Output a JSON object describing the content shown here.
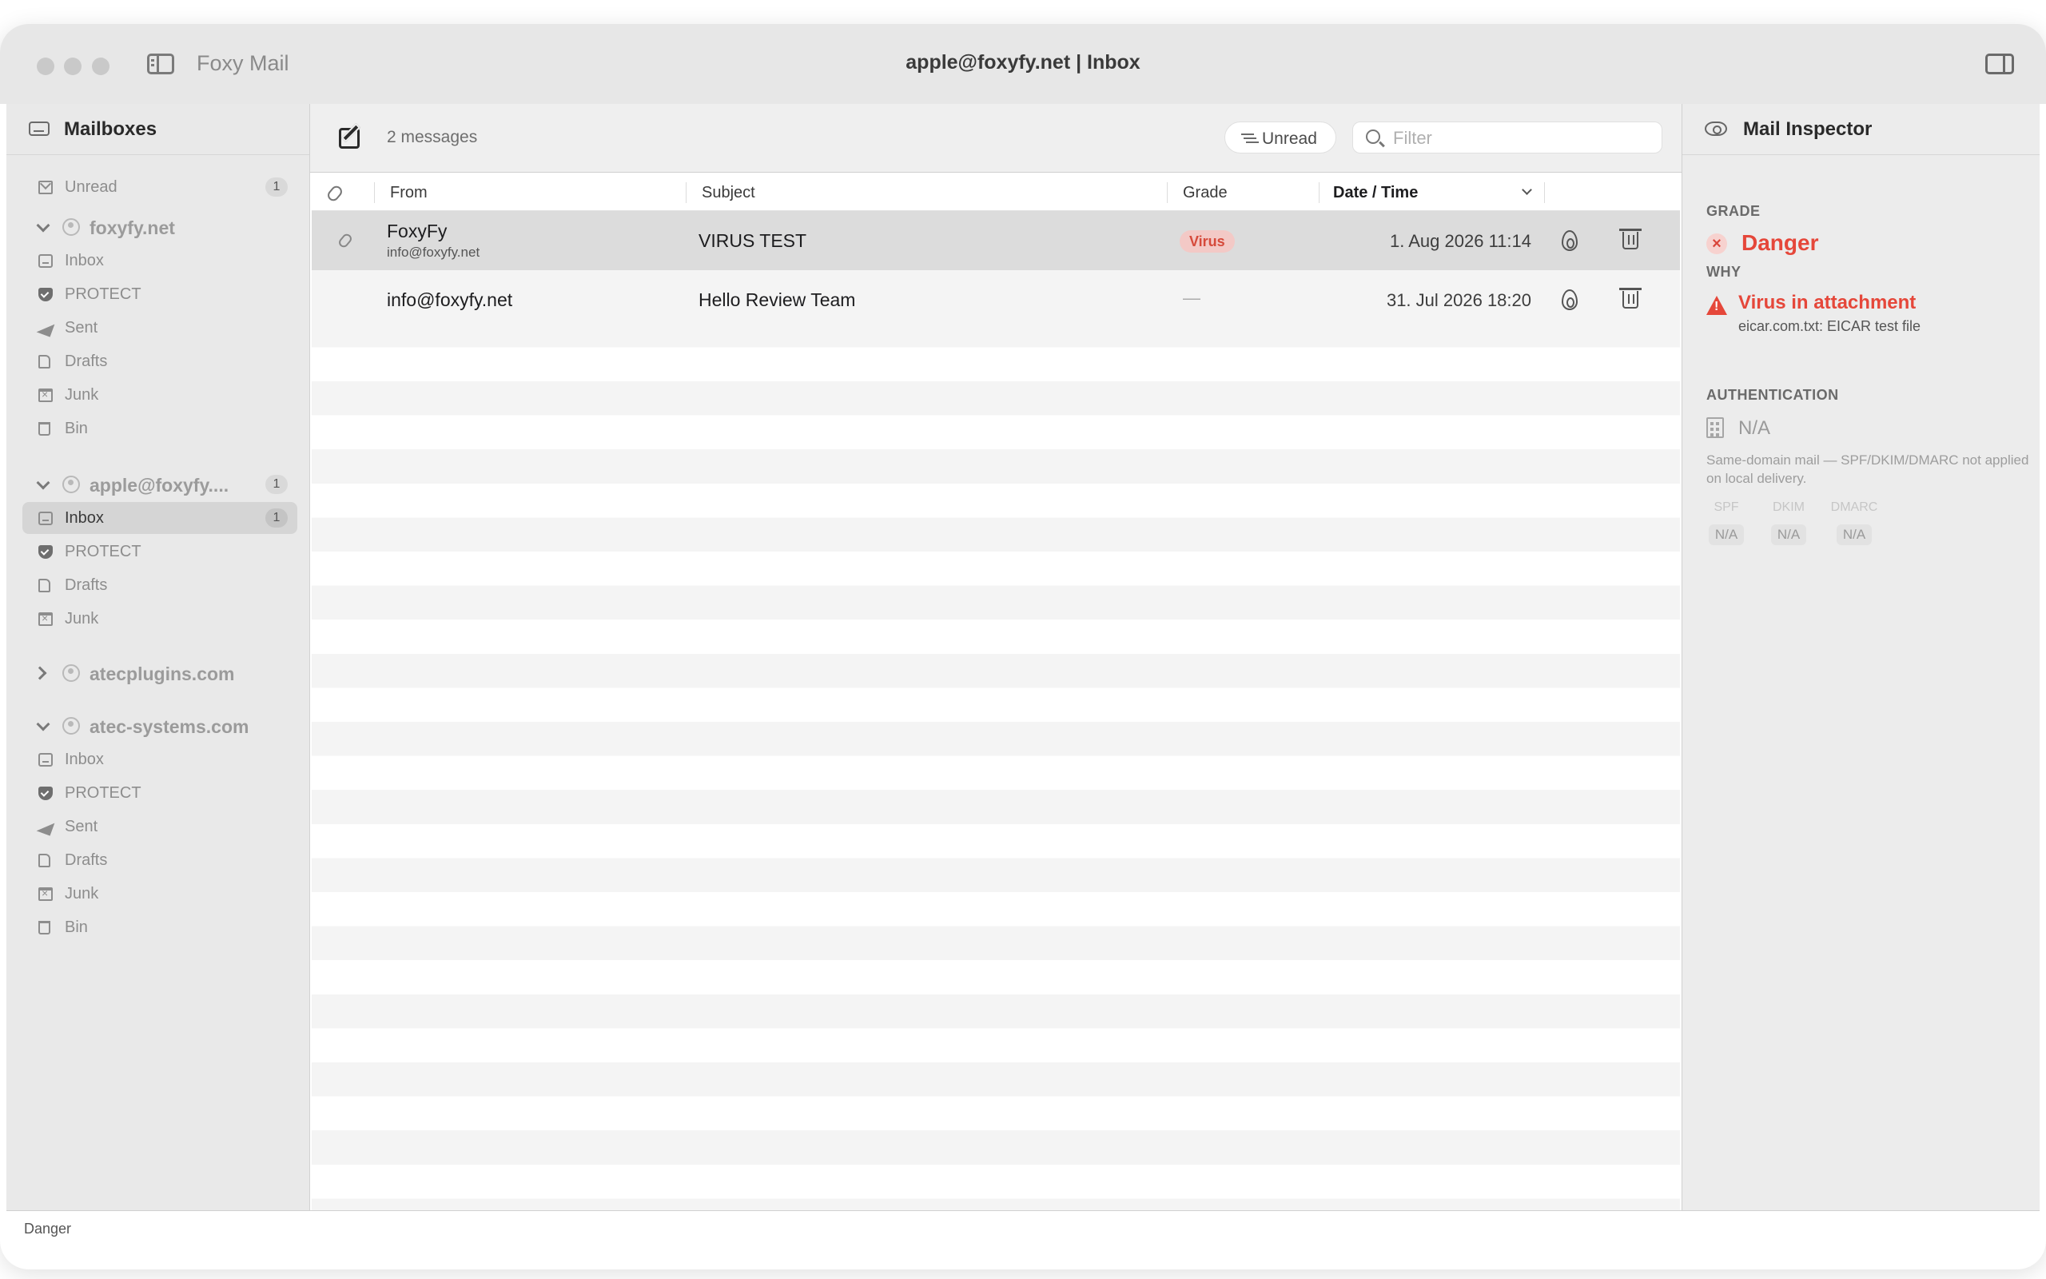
{
  "window": {
    "app_name": "Foxy Mail",
    "title": "apple@foxyfy.net | Inbox"
  },
  "sidebar": {
    "header": "Mailboxes",
    "unread": {
      "label": "Unread",
      "count": "1"
    },
    "groups": [
      {
        "name": "foxyfy.net",
        "expanded": true,
        "items": [
          {
            "label": "Inbox",
            "icon": "inbox-icon"
          },
          {
            "label": "PROTECT",
            "icon": "shield-icon"
          },
          {
            "label": "Sent",
            "icon": "sent-icon"
          },
          {
            "label": "Drafts",
            "icon": "drafts-icon"
          },
          {
            "label": "Junk",
            "icon": "junk-icon"
          },
          {
            "label": "Bin",
            "icon": "bin-icon"
          }
        ]
      },
      {
        "name": "apple@foxyfy....",
        "count": "1",
        "expanded": true,
        "items": [
          {
            "label": "Inbox",
            "icon": "inbox-icon",
            "count": "1",
            "selected": true
          },
          {
            "label": "PROTECT",
            "icon": "shield-icon"
          },
          {
            "label": "Drafts",
            "icon": "drafts-icon"
          },
          {
            "label": "Junk",
            "icon": "junk-icon"
          }
        ]
      },
      {
        "name": "atecplugins.com",
        "expanded": false,
        "items": []
      },
      {
        "name": "atec-systems.com",
        "expanded": true,
        "items": [
          {
            "label": "Inbox",
            "icon": "inbox-icon"
          },
          {
            "label": "PROTECT",
            "icon": "shield-icon"
          },
          {
            "label": "Sent",
            "icon": "sent-icon"
          },
          {
            "label": "Drafts",
            "icon": "drafts-icon"
          },
          {
            "label": "Junk",
            "icon": "junk-icon"
          },
          {
            "label": "Bin",
            "icon": "bin-icon"
          }
        ]
      }
    ]
  },
  "list": {
    "count_text": "2 messages",
    "unread_filter_label": "Unread",
    "filter_placeholder": "Filter",
    "columns": {
      "from": "From",
      "subject": "Subject",
      "grade": "Grade",
      "date": "Date / Time"
    },
    "messages": [
      {
        "from": "FoxyFy",
        "from_email": "info@foxyfy.net",
        "subject": "VIRUS TEST",
        "grade": "Virus",
        "date": "1. Aug 2026 11:14",
        "has_attachment": true,
        "selected": true
      },
      {
        "from": "info@foxyfy.net",
        "from_email": "",
        "subject": "Hello Review Team",
        "grade": "—",
        "date": "31. Jul 2026 18:20",
        "has_attachment": false,
        "selected": false
      }
    ]
  },
  "inspector": {
    "title": "Mail Inspector",
    "grade_label": "GRADE",
    "grade_value": "Danger",
    "why_label": "WHY",
    "why_value": "Virus in attachment",
    "why_detail": "eicar.com.txt: EICAR test file",
    "auth_label": "AUTHENTICATION",
    "auth_value": "N/A",
    "auth_note": "Same-domain mail — SPF/DKIM/DMARC not applied on local delivery.",
    "checks": [
      {
        "name": "SPF",
        "value": "N/A"
      },
      {
        "name": "DKIM",
        "value": "N/A"
      },
      {
        "name": "DMARC",
        "value": "N/A"
      }
    ]
  },
  "statusbar": {
    "text": "Danger"
  },
  "colors": {
    "danger": "#e5473a",
    "virus_pill_bg": "#f3c9c6",
    "selected_row": "#dcdcdc",
    "sidebar_bg": "#e9e9e9"
  }
}
